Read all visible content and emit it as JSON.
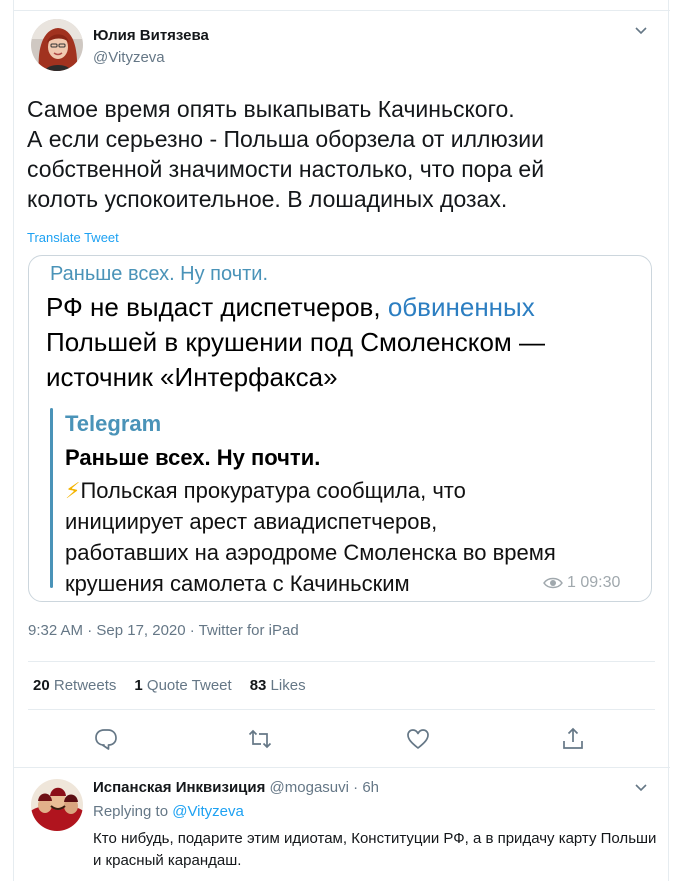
{
  "tweet": {
    "author_name": "Юлия Витязева",
    "author_handle": "@Vityzeva",
    "text_lines": [
      "Самое время опять выкапывать Качиньского.",
      "А если серьезно - Польша оборзела от иллюзии",
      "собственной значимости настолько, что пора ей",
      "колоть успокоительное. В лошадиных дозах."
    ],
    "translate_label": "Translate Tweet",
    "timestamp": "9:32 AM · Sep 17, 2020 · Twitter for iPad",
    "retweets_count": "20",
    "retweets_label": "Retweets",
    "quotes_count": "1",
    "quotes_label": "Quote Tweet",
    "likes_count": "83",
    "likes_label": "Likes"
  },
  "card": {
    "channel": "Раньше всех. Ну почти.",
    "headline_line1_plain": "РФ не выдаст диспетчеров, ",
    "headline_line1_link": "обвиненных",
    "headline_line2": "Польшей в крушении под Смоленском —",
    "headline_line3": "источник «Интерфакса»",
    "quote_source": "Telegram",
    "quote_title": "Раньше всех. Ну почти.",
    "quote_icon": "⚡",
    "quote_lines": [
      "Польская прокуратура сообщила, что",
      "инициирует арест авиадиспетчеров,",
      "работавших на аэродроме Смоленска во время",
      "крушения самолета с Качиньским"
    ],
    "meta": "1 09:30"
  },
  "reply": {
    "author_name": "Испанская Инквизиция",
    "author_handle": "@mogasuvi",
    "time": "· 6h",
    "replying_prefix": "Replying to",
    "replying_handle": "@Vityzeva",
    "text": "Кто нибудь, подарите этим идиотам, Конституции РФ, а в придачу карту Польши и красный карандаш."
  },
  "colors": {
    "accent": "#1da1f2",
    "muted": "#657786",
    "telegram_blue": "#4a93b8",
    "link_blue": "#2c7ec1"
  },
  "icons": [
    "chevron-down-icon",
    "reply-icon",
    "retweet-icon",
    "like-icon",
    "share-icon",
    "eye-icon",
    "lightning-icon"
  ]
}
